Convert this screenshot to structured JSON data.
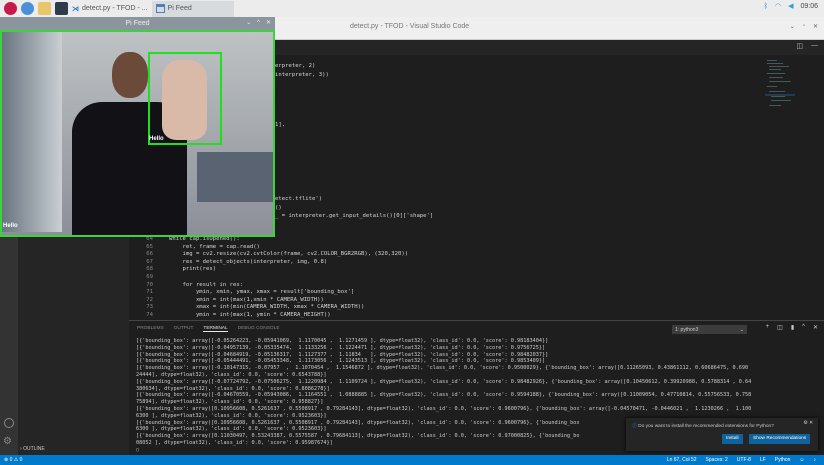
{
  "taskbar": {
    "tasks": [
      "detect.py - TFOD - ...",
      "Pi Feed"
    ],
    "clock": "09:06"
  },
  "vscode": {
    "title": "detect.py - TFOD - Visual Studio Code",
    "outline": "OUTLINE"
  },
  "pifeed": {
    "title": "Pi Feed",
    "label1": "Hello",
    "label2": "Hello"
  },
  "editor": {
    "partial": [
      {
        "ln": "",
        "code": "erpreter, 2)"
      },
      {
        "ln": "",
        "code": "interpreter, 3))"
      },
      {
        "ln": "",
        "code": "1],"
      },
      {
        "ln": "",
        "code": "etect.tflite')"
      },
      {
        "ln": "",
        "code": "()"
      },
      {
        "ln": "",
        "code": "_ = interpreter.get_input_details()[0]['shape']"
      }
    ],
    "lines": [
      {
        "ln": "64",
        "code": "while cap.isOpened():"
      },
      {
        "ln": "65",
        "code": "    ret, frame = cap.read()"
      },
      {
        "ln": "66",
        "code": "    img = cv2.resize(cv2.cvtColor(frame, cv2.COLOR_BGR2RGB), (320,320))"
      },
      {
        "ln": "67",
        "code": "    res = detect_objects(interpreter, img, 0.8)"
      },
      {
        "ln": "68",
        "code": "    print(res)"
      },
      {
        "ln": "69",
        "code": ""
      },
      {
        "ln": "70",
        "code": "    for result in res:"
      },
      {
        "ln": "71",
        "code": "        ymin, xmin, ymax, xmax = result['bounding_box']"
      },
      {
        "ln": "72",
        "code": "        xmin = int(max(1,xmin * CAMERA_WIDTH))"
      },
      {
        "ln": "73",
        "code": "        xmax = int(min(CAMERA_WIDTH, xmax * CAMERA_WIDTH))"
      },
      {
        "ln": "74",
        "code": "        ymin = int(max(1, ymin * CAMERA_HEIGHT))"
      }
    ]
  },
  "panel": {
    "tabs": [
      "PROBLEMS",
      "OUTPUT",
      "TERMINAL",
      "DEBUG CONSOLE"
    ],
    "terminal_select": "1: python3",
    "terminal": "[{'bounding_box': array([-0.05264223, -0.05941069,  1.1170045 ,  1.1271459 ], dtype=float32), 'class_id': 0.0, 'score': 0.98183404}]\n[{'bounding_box': array([-0.04957139, -0.05335474,  1.1133256 ,  1.1224471 ], dtype=float32), 'class_id': 0.0, 'score': 0.9756725}]\n[{'bounding_box': array([-0.04684919, -0.05136317,  1.1127377 ,  1.11834   ], dtype=float32), 'class_id': 0.0, 'score': 0.98482037}]\n[{'bounding_box': array([-0.05444491, -0.05453348,  1.1173056 ,  1.1243513 ], dtype=float32), 'class_id': 0.0, 'score': 0.9853409}]\n[{'bounding_box': array([-0.10147315, -0.07957  ,  1.1070454 ,  1.1546872 ], dtype=float32), 'class_id': 0.0, 'score': 0.9500029}, {'bounding_box': array([0.11265093, 0.43861112, 0.60686475, 0.690\n24444], dtype=float32), 'class_id': 0.0, 'score': 0.6543788}]\n[{'bounding_box': array([-0.07724792, -0.07506275,  1.1220984 ,  1.1109724 ], dtype=float32), 'class_id': 0.0, 'score': 0.98482926}, {'bounding_box': array([0.10450612, 0.39920988, 0.5788314 , 0.64\n380634], dtype=float32), 'class_id': 0.0, 'score': 0.8086278}]\n[{'bounding_box': array([-0.04670559, -0.05943086,  1.1164551 ,  1.0888885 ], dtype=float32), 'class_id': 0.0, 'score': 0.9594188}, {'bounding_box': array([0.11009054, 0.47710814, 0.55756533, 0.758\n75894], dtype=float32), 'class_id': 0.0, 'score': 0.958827}]\n[{'bounding_box': array([0.10956608, 0.5261637 , 0.5508917 , 0.79284143], dtype=float32), 'class_id': 0.0, 'score': 0.9600796}, {'bounding_box': array([-0.04570471, -0.0446021 ,  1.1230266 ,  1.100\n6300 ], dtype=float32), 'class_id': 0.0, 'score': 0.9523603}]\n[{'bounding_box': array([0.10956608, 0.5261637 , 0.5508917 , 0.79284143], dtype=float32), 'class_id': 0.0, 'score': 0.9600796}, {'bounding_box\n6300 ], dtype=float32), 'class_id': 0.0, 'score': 0.9523603}]\n[{'bounding_box': array([0.11030497, 0.53243387, 0.5575587 , 0.79684113], dtype=float32), 'class_id': 0.0, 'score': 0.97000825}, {'bounding_bo\n08052 ], dtype=float32), 'class_id': 0.0, 'score': 0.95987674}]\n▯"
  },
  "notification": {
    "message": "Do you want to install the recommended extensions for Python?",
    "install": "Install",
    "show": "Show Recommendations"
  },
  "status": {
    "left": "⊗ 0 ⚠ 0",
    "items": [
      "Ln 67, Col 52",
      "Spaces: 2",
      "UTF-8",
      "LF",
      "Python"
    ]
  }
}
